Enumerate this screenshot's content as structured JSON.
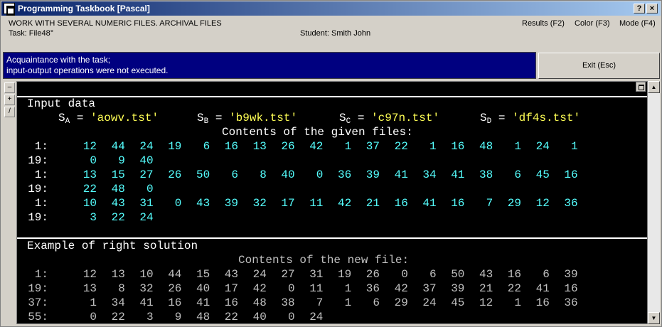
{
  "window": {
    "title": "Programming Taskbook [Pascal]",
    "help_button": "?",
    "close_button": "×"
  },
  "info": {
    "task_heading": "WORK WITH SEVERAL NUMERIC FILES. ARCHIVAL FILES",
    "task_label": "Task: File48°",
    "student_label": "Student: Smith John",
    "results": "Results (F2)",
    "color": "Color (F3)",
    "mode": "Mode (F4)"
  },
  "status": {
    "line1": "Acquaintance with the task;",
    "line2": " input-output operations were not executed."
  },
  "exit_button": "Exit (Esc)",
  "side_buttons": [
    "–",
    "+",
    "/"
  ],
  "console": {
    "input_title": "Input data",
    "files": [
      {
        "letter": "S",
        "sub": "A",
        "eq": " = ",
        "name": "'aowv.tst'"
      },
      {
        "letter": "S",
        "sub": "B",
        "eq": " = ",
        "name": "'b9wk.tst'"
      },
      {
        "letter": "S",
        "sub": "C",
        "eq": " = ",
        "name": "'c97n.tst'"
      },
      {
        "letter": "S",
        "sub": "D",
        "eq": " = ",
        "name": "'df4s.tst'"
      }
    ],
    "given_heading": "Contents of the given files:",
    "given_rows": [
      {
        "label": "1:",
        "values": [
          "12",
          "44",
          "24",
          "19",
          "6",
          "16",
          "13",
          "26",
          "42",
          "1",
          "37",
          "22",
          "1",
          "16",
          "48",
          "1",
          "24",
          "1"
        ]
      },
      {
        "label": "19:",
        "values": [
          "0",
          "9",
          "40"
        ]
      },
      {
        "label": "1:",
        "values": [
          "13",
          "15",
          "27",
          "26",
          "50",
          "6",
          "8",
          "40",
          "0",
          "36",
          "39",
          "41",
          "34",
          "41",
          "38",
          "6",
          "45",
          "16"
        ]
      },
      {
        "label": "19:",
        "values": [
          "22",
          "48",
          "0"
        ]
      },
      {
        "label": "1:",
        "values": [
          "10",
          "43",
          "31",
          "0",
          "43",
          "39",
          "32",
          "17",
          "11",
          "42",
          "21",
          "16",
          "41",
          "16",
          "7",
          "29",
          "12",
          "36"
        ]
      },
      {
        "label": "19:",
        "values": [
          "3",
          "22",
          "24"
        ]
      }
    ],
    "example_title": "Example of right solution",
    "new_heading": "Contents of the new file:",
    "new_rows": [
      {
        "label": "1:",
        "values": [
          "12",
          "13",
          "10",
          "44",
          "15",
          "43",
          "24",
          "27",
          "31",
          "19",
          "26",
          "0",
          "6",
          "50",
          "43",
          "16",
          "6",
          "39"
        ]
      },
      {
        "label": "19:",
        "values": [
          "13",
          "8",
          "32",
          "26",
          "40",
          "17",
          "42",
          "0",
          "11",
          "1",
          "36",
          "42",
          "37",
          "39",
          "21",
          "22",
          "41",
          "16"
        ]
      },
      {
        "label": "37:",
        "values": [
          "1",
          "34",
          "41",
          "16",
          "41",
          "16",
          "48",
          "38",
          "7",
          "1",
          "6",
          "29",
          "24",
          "45",
          "12",
          "1",
          "16",
          "36"
        ]
      },
      {
        "label": "55:",
        "values": [
          "0",
          "22",
          "3",
          "9",
          "48",
          "22",
          "40",
          "0",
          "24"
        ]
      }
    ]
  }
}
